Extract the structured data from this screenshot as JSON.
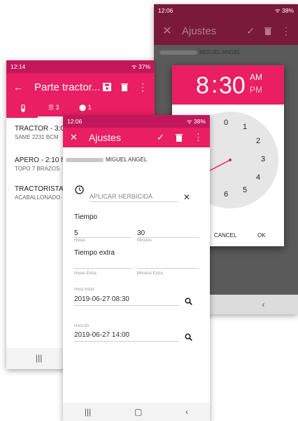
{
  "colors": {
    "accent": "#e91e63",
    "accent_dark": "#c2185b",
    "dim_accent": "#7a1a3a",
    "dim_bg": "#5a5a5a"
  },
  "back_phone": {
    "status": {
      "time": "12:06",
      "battery": "38%"
    },
    "title": "Ajustes",
    "user_name": "MIGUEL ANGEL",
    "picker": {
      "hour": "8",
      "sep": ":",
      "minute": "30",
      "am": "AM",
      "pm": "PM",
      "numbers": [
        "0",
        "1",
        "2",
        "3",
        "4",
        "5",
        "6"
      ],
      "cancel": "CANCEL",
      "ok": "OK"
    }
  },
  "mid_phone": {
    "status": {
      "time": "12:14",
      "battery": "37%"
    },
    "title": "Parte tractor...",
    "tabs": {
      "list_count": "3",
      "location_count": "1"
    },
    "items": [
      {
        "title": "TRACTOR - 3:00",
        "subtitle": "SAME 2231 BCM"
      },
      {
        "title": "APERO - 2:10 h",
        "subtitle": "TOPO 7 BRAZOS"
      },
      {
        "title": "TRACTORISTA",
        "subtitle": "ACABALLONADO"
      }
    ]
  },
  "front_phone": {
    "status": {
      "time": "12:06",
      "battery": "38%"
    },
    "title": "Ajustes",
    "user_name": "MIGUEL ANGEL",
    "task_placeholder": "APLICAR HERBICIDA",
    "tiempo": {
      "label": "Tiempo",
      "hours_value": "5",
      "hours_label": "Horas",
      "minutes_value": "30",
      "minutes_label": "Minutos"
    },
    "extra": {
      "label": "Tiempo extra",
      "hours_label": "Horas Extra",
      "minutes_label": "Minutos Extra"
    },
    "start": {
      "label": "Hora inicio:",
      "value": "2019-06-27 08:30"
    },
    "end": {
      "label": "Hora fin:",
      "value": "2019-06-27 14:00"
    }
  }
}
